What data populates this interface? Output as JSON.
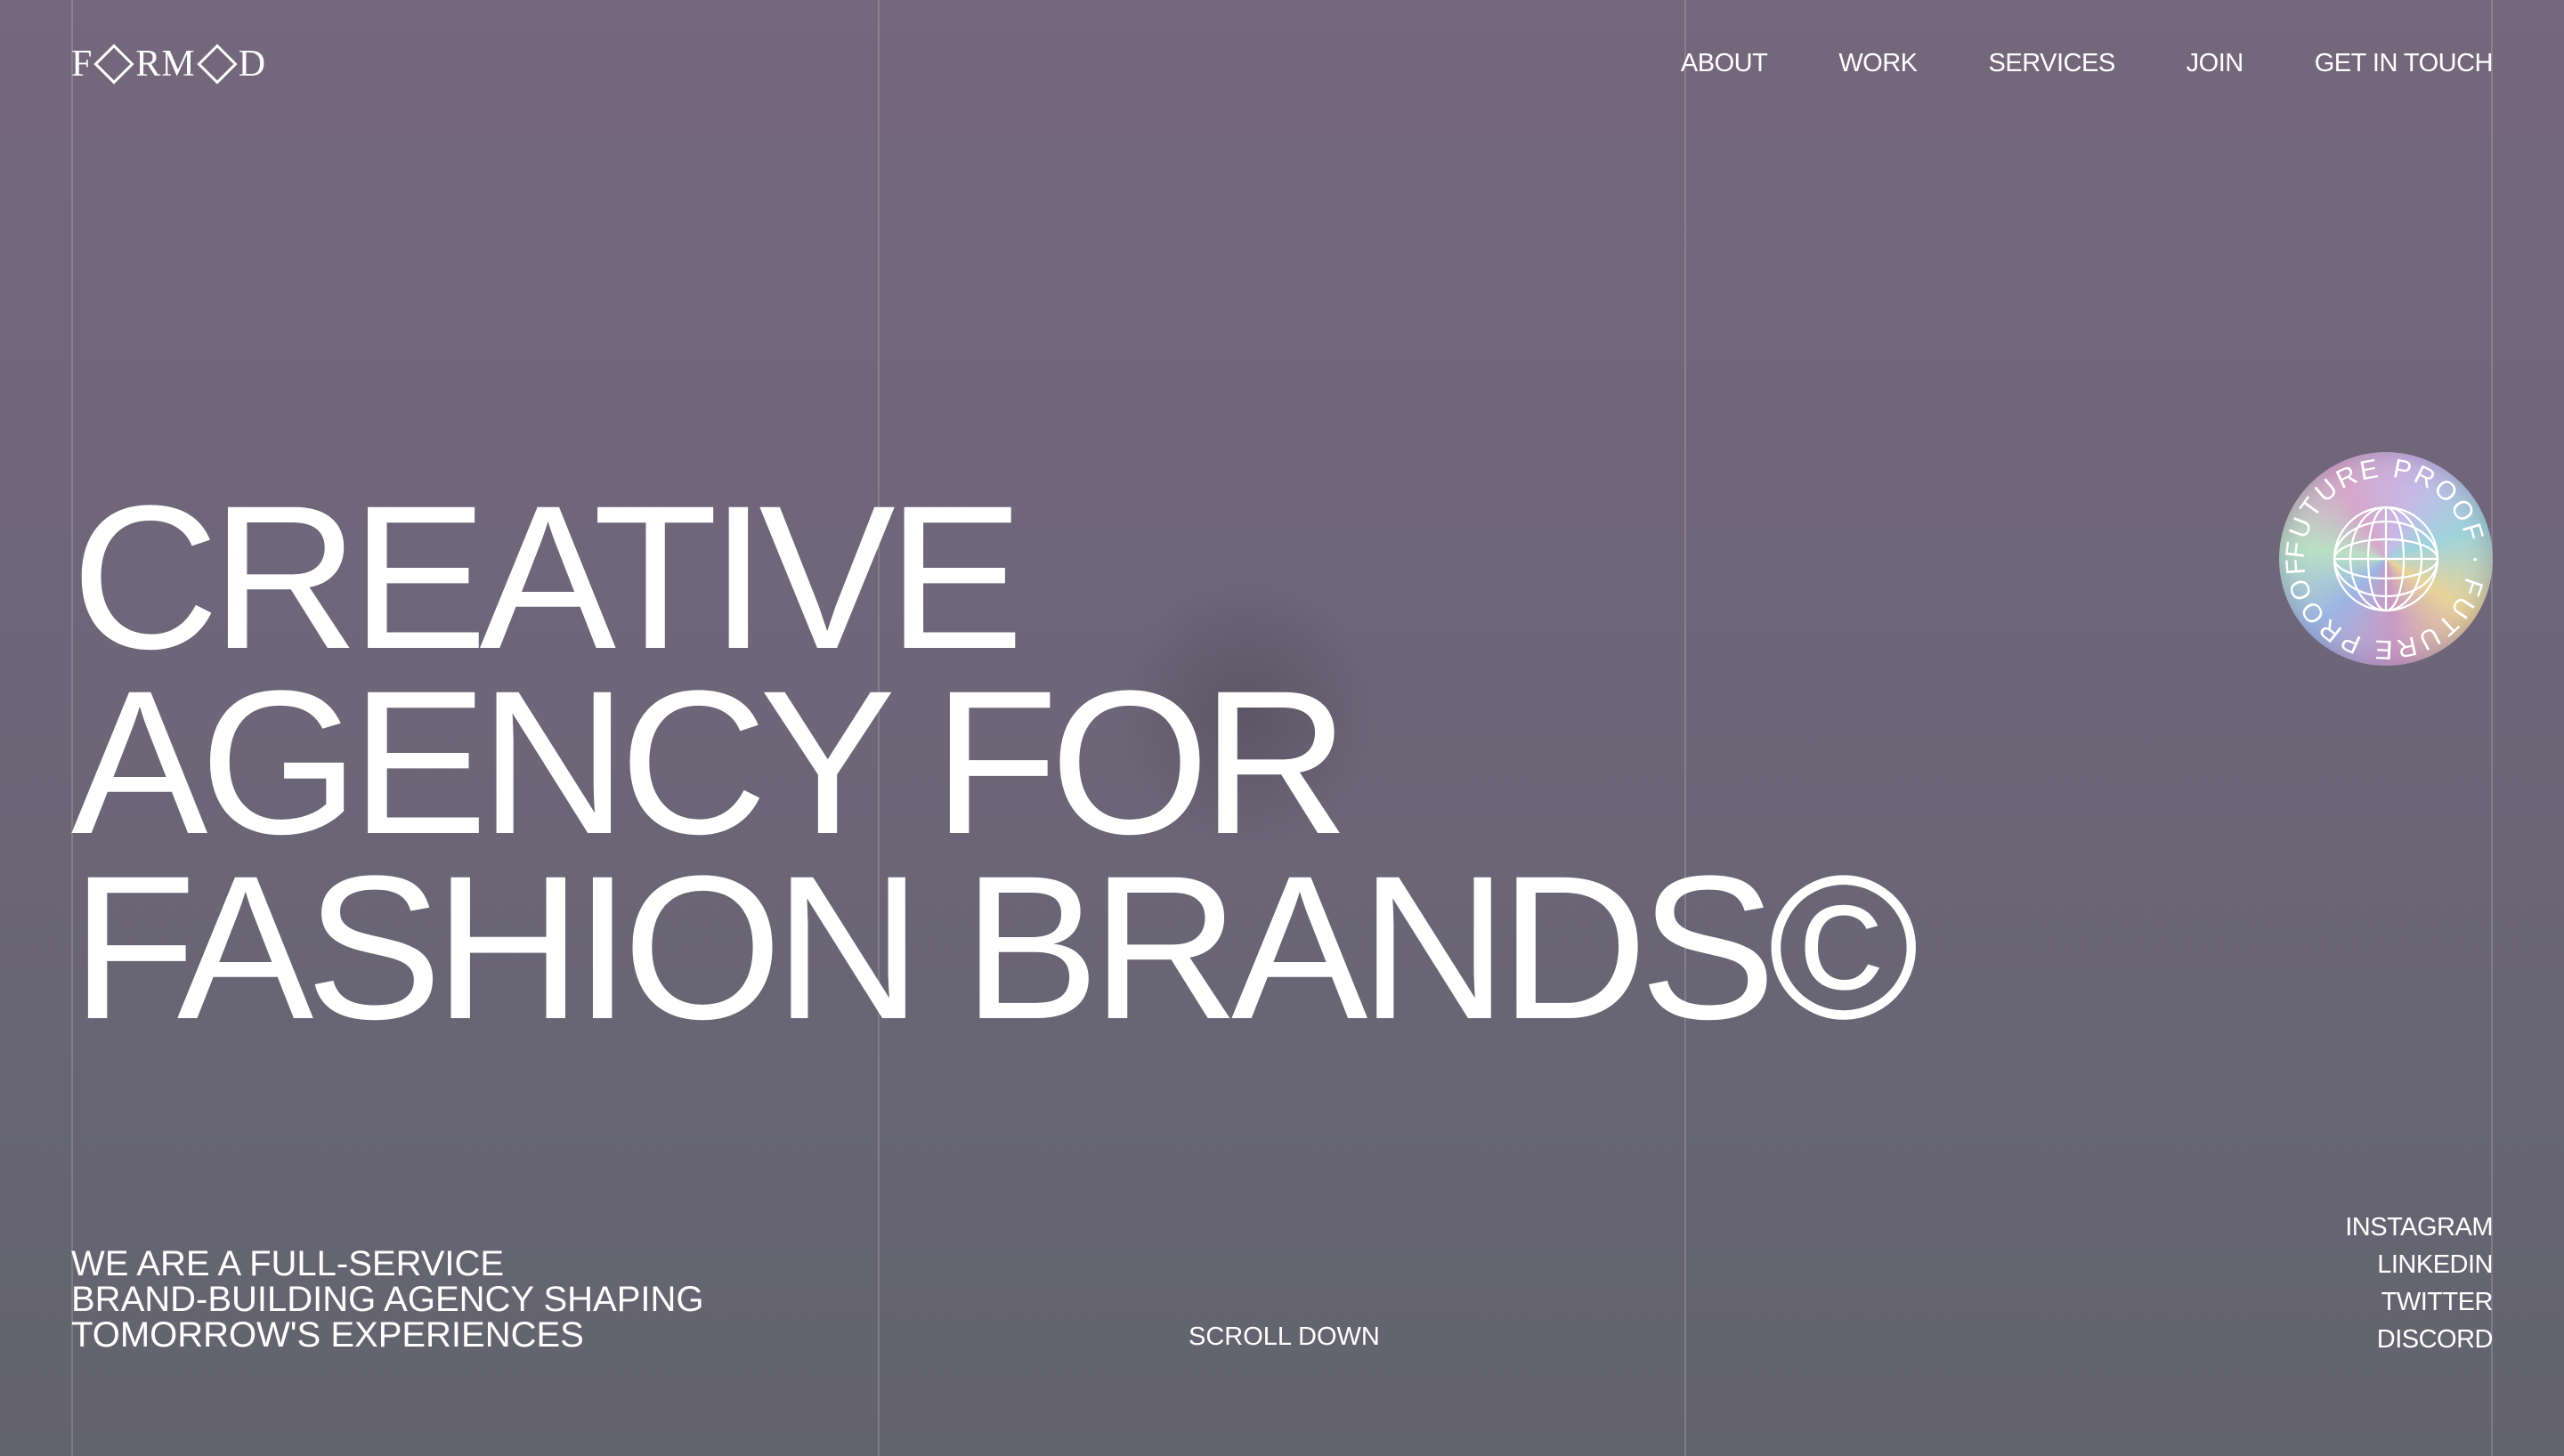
{
  "brand": {
    "logo_before": "F",
    "logo_after": "RM",
    "logo_after2": "D"
  },
  "nav": {
    "items": [
      {
        "label": "ABOUT"
      },
      {
        "label": "WORK"
      },
      {
        "label": "SERVICES"
      },
      {
        "label": "JOIN"
      },
      {
        "label": "GET IN TOUCH"
      }
    ]
  },
  "hero": {
    "line1": "CREATIVE",
    "line2": "AGENCY FOR",
    "line3": "FASHION BRANDS©"
  },
  "badge": {
    "text": "FUTURE PROOF · FUTURE PROOF · ",
    "icon": "globe-icon"
  },
  "tagline": {
    "line1": "WE ARE A FULL-SERVICE",
    "line2": "BRAND-BUILDING AGENCY SHAPING",
    "line3": "TOMORROW'S EXPERIENCES"
  },
  "scroll": {
    "label": "SCROLL DOWN"
  },
  "social": {
    "items": [
      {
        "label": "INSTAGRAM"
      },
      {
        "label": "LINKEDIN"
      },
      {
        "label": "TWITTER"
      },
      {
        "label": "DISCORD"
      }
    ]
  },
  "colors": {
    "background_top": "#75677c",
    "background_bottom": "#63636e",
    "text": "#ffffff"
  }
}
